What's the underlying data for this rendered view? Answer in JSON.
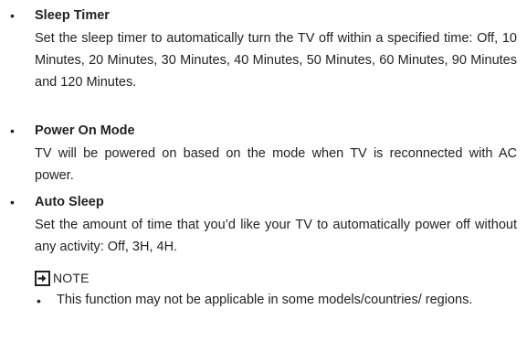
{
  "items": [
    {
      "title": "Sleep Timer",
      "description": "Set the sleep timer to automatically turn the TV off within a specified time: Off, 10 Minutes, 20 Minutes, 30 Minutes, 40 Minutes, 50 Minutes, 60 Minutes, 90 Minutes and 120 Minutes."
    },
    {
      "title": "Power On Mode",
      "description": "TV will be powered on based on the mode when TV is reconnected with AC power."
    },
    {
      "title": "Auto Sleep",
      "description": "Set the amount of time that you’d like your TV to automatically power off without any activity: Off, 3H, 4H."
    }
  ],
  "note": {
    "icon": "arrow-right-box-icon",
    "label": "NOTE",
    "items": [
      "This function may not be applicable in some models/countries/ regions."
    ]
  },
  "bullet_char": "•",
  "colors": {
    "text": "#222222",
    "background": "#ffffff"
  }
}
